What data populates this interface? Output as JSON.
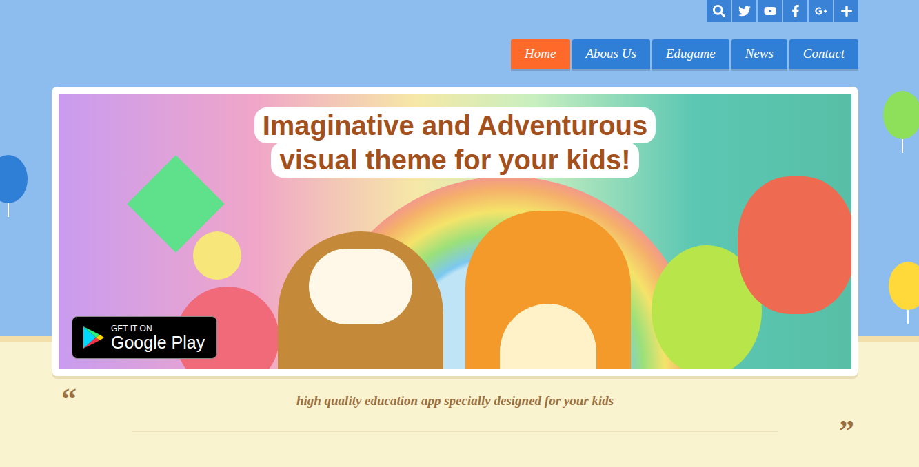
{
  "nav": [
    {
      "label": "Home",
      "selected": true
    },
    {
      "label": "Abous Us",
      "selected": false
    },
    {
      "label": "Edugame",
      "selected": false
    },
    {
      "label": "News",
      "selected": false
    },
    {
      "label": "Contact",
      "selected": false
    }
  ],
  "banner": {
    "headline": [
      "Imaginative and Adventurous",
      "visual theme for your kids!"
    ],
    "badge": {
      "small": "GET IT ON",
      "big": "Google Play"
    }
  },
  "quote": {
    "open": "“",
    "text": "high quality education app specially designed for your kids",
    "close": "”"
  }
}
